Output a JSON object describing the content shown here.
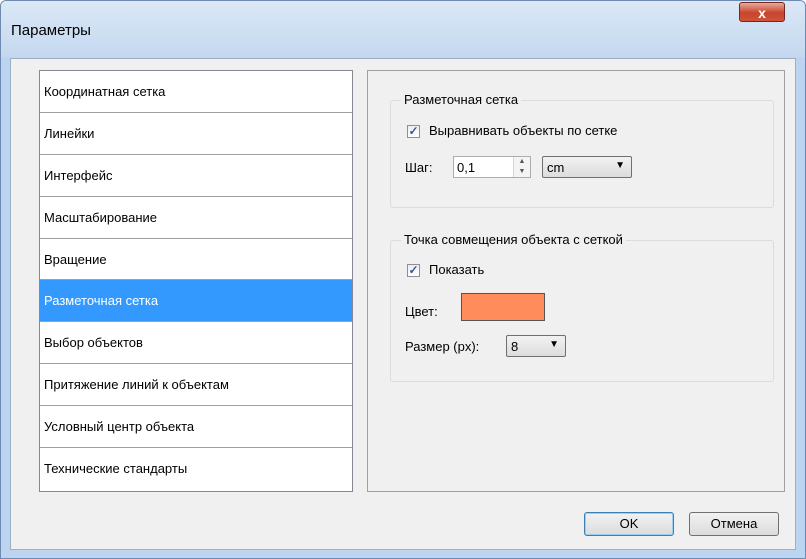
{
  "window": {
    "title": "Параметры",
    "close_glyph": "x"
  },
  "nav": {
    "items": [
      {
        "label": "Координатная сетка",
        "selected": false
      },
      {
        "label": "Линейки",
        "selected": false
      },
      {
        "label": "Интерфейс",
        "selected": false
      },
      {
        "label": "Масштабирование",
        "selected": false
      },
      {
        "label": "Вращение",
        "selected": false
      },
      {
        "label": "Разметочная сетка",
        "selected": true
      },
      {
        "label": "Выбор объектов",
        "selected": false
      },
      {
        "label": "Притяжение линий к объектам",
        "selected": false
      },
      {
        "label": "Условный центр объекта",
        "selected": false
      },
      {
        "label": "Технические стандарты",
        "selected": false
      }
    ]
  },
  "grid_group": {
    "title": "Разметочная сетка",
    "align_checkbox_label": "Выравнивать объекты по сетке",
    "align_checked": true,
    "step_label": "Шаг:",
    "step_value": "0,1",
    "unit_value": "cm"
  },
  "snap_group": {
    "title": "Точка совмещения объекта с сеткой",
    "show_checkbox_label": "Показать",
    "show_checked": true,
    "color_label": "Цвет:",
    "color_value": "#ff8c5a",
    "size_label": "Размер (px):",
    "size_value": "8"
  },
  "buttons": {
    "ok": "OK",
    "cancel": "Отмена"
  },
  "icons": {
    "checkmark": "check-icon",
    "spin_up": "triangle-up-icon",
    "spin_down": "triangle-down-icon",
    "dropdown": "chevron-down-icon"
  }
}
